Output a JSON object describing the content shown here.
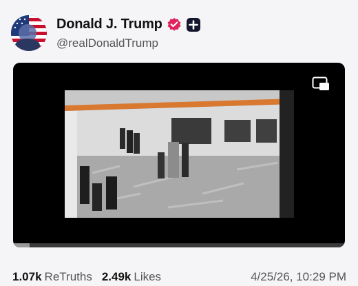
{
  "post": {
    "author_name": "Donald J. Trump",
    "author_handle": "@realDonaldTrump",
    "avatar_icon": "avatar-flag-portrait",
    "verified_icon": "verified-badge-icon",
    "plus_icon": "plus-badge-icon",
    "verified_color": "#e0245e"
  },
  "media": {
    "type": "video",
    "pip_icon": "picture-in-picture-icon",
    "progress": 0.05
  },
  "stats": {
    "retruths_count": "1.07k",
    "retruths_label": "ReTruths",
    "likes_count": "2.49k",
    "likes_label": "Likes",
    "timestamp": "4/25/26, 10:29 PM"
  }
}
